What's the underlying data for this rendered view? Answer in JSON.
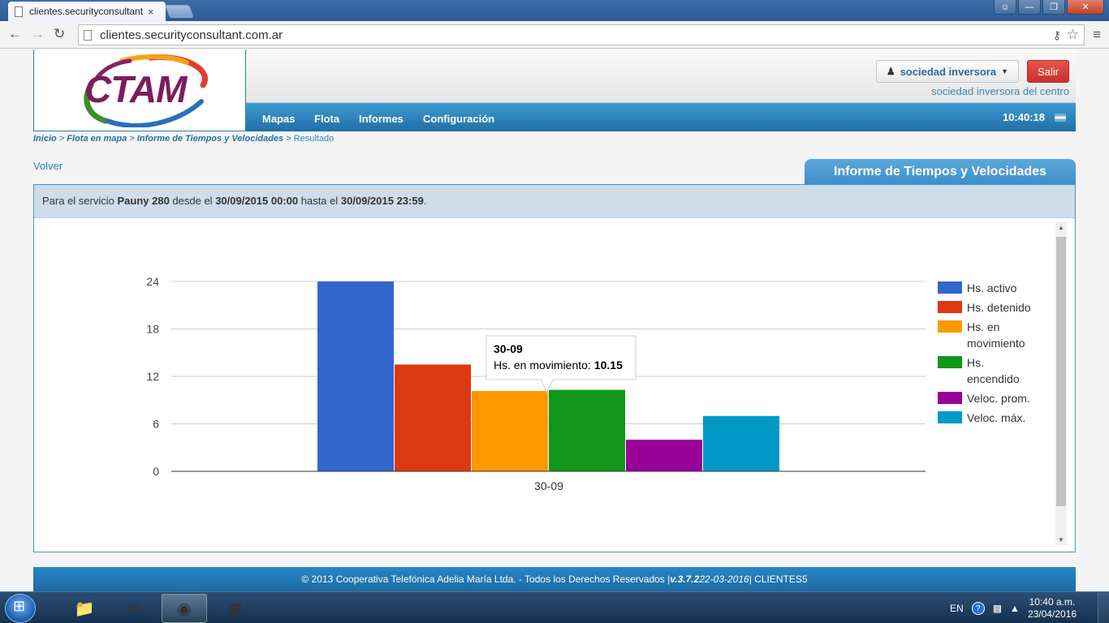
{
  "browser": {
    "tab_title": "clientes.securityconsultant",
    "tab_close": "×",
    "url": "clientes.securityconsultant.com.ar"
  },
  "header": {
    "logo_text": "CTAM",
    "user_button": "sociedad inversora",
    "logout_button": "Salir",
    "subtitle": "sociedad inversora del centro",
    "clock": "10:40:18",
    "nav": [
      "Mapas",
      "Flota",
      "Informes",
      "Configuración"
    ]
  },
  "breadcrumb": {
    "inicio": "Inicio",
    "flota": "Flota en mapa",
    "informe": "Informe de Tiempos y Velocidades",
    "sep": ">",
    "current": "Resultado"
  },
  "volver": "Volver",
  "report_title": "Informe de Tiempos y Velocidades",
  "info": {
    "p1": "Para el servicio ",
    "service": "Pauny 280",
    "p2": " desde el ",
    "from": "30/09/2015 00:00",
    "p3": " hasta el ",
    "to": "30/09/2015 23:59",
    "p4": "."
  },
  "chart_data": {
    "type": "bar",
    "categories": [
      "30-09"
    ],
    "yticks": [
      0,
      6,
      12,
      18,
      24
    ],
    "ylim": [
      0,
      24
    ],
    "grid": true,
    "legend_position": "right",
    "series": [
      {
        "name": "Hs. activo",
        "color": "#3366cc",
        "values": [
          24
        ]
      },
      {
        "name": "Hs. detenido",
        "color": "#dc3912",
        "values": [
          13.5
        ]
      },
      {
        "name": "Hs. en movimiento",
        "color": "#ff9900",
        "values": [
          10.15
        ]
      },
      {
        "name": "Hs. encendido",
        "color": "#109618",
        "values": [
          10.3
        ]
      },
      {
        "name": "Veloc. prom.",
        "color": "#990099",
        "values": [
          4
        ]
      },
      {
        "name": "Veloc. máx.",
        "color": "#0099c6",
        "values": [
          7
        ]
      }
    ],
    "tooltip": {
      "title": "30-09",
      "label": "Hs. en movimiento:",
      "value": "10.15"
    }
  },
  "footer": {
    "text": "© 2013 Cooperativa Telefónica Adelia María Ltda. - Todos los Derechos Reservados | ",
    "version": "v.3.7.2",
    "date": " 22-03-2016",
    "suffix": " | CLIENTES5"
  },
  "taskbar": {
    "lang": "EN",
    "time": "10:40 a.m.",
    "date": "23/04/2016"
  }
}
